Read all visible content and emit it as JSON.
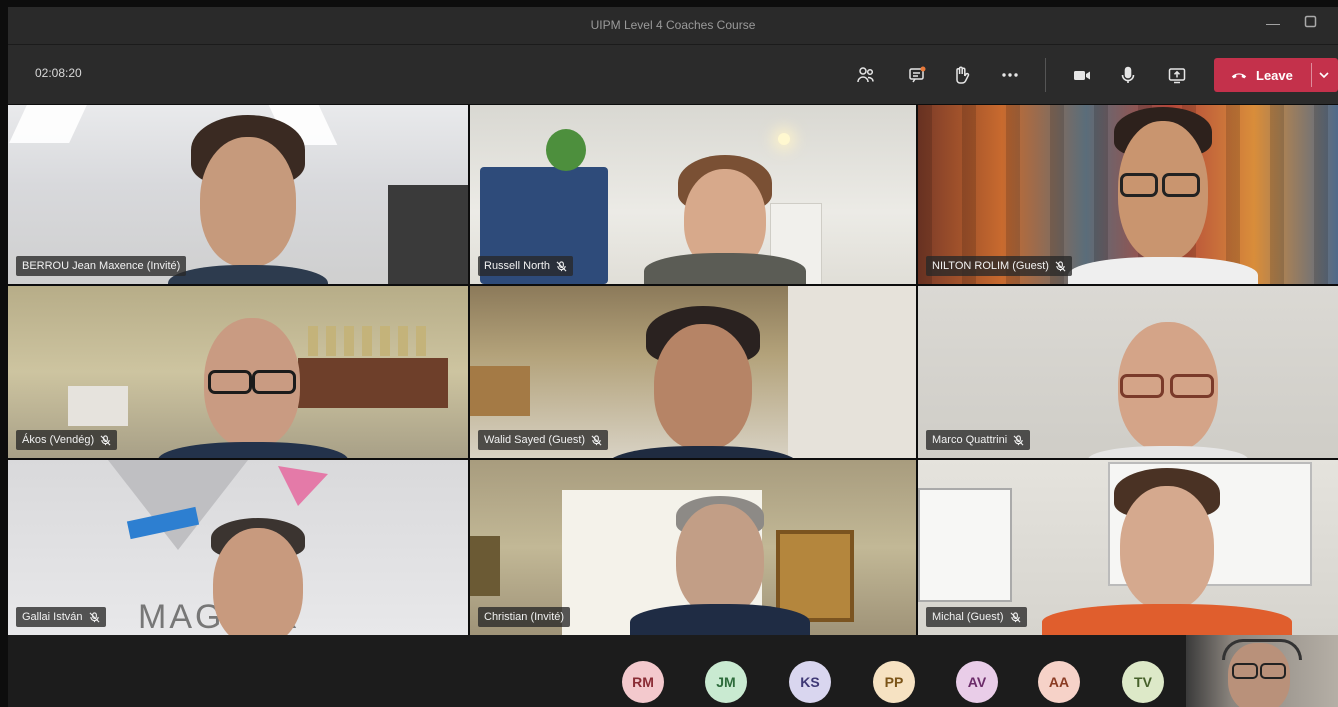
{
  "window": {
    "title": "UIPM Level 4 Coaches Course"
  },
  "toolbar": {
    "timer": "02:08:20",
    "icons": [
      "people-icon",
      "chat-icon",
      "raise-hand-icon",
      "more-icon",
      "camera-icon",
      "mic-icon",
      "share-icon"
    ],
    "leave_label": "Leave"
  },
  "participants": [
    {
      "name": "BERROU Jean Maxence (Invité)",
      "muted": false
    },
    {
      "name": "Russell North",
      "muted": true
    },
    {
      "name": "NILTON ROLIM (Guest)",
      "muted": true
    },
    {
      "name": "Ákos (Vendég)",
      "muted": true
    },
    {
      "name": "Walid Sayed (Guest)",
      "muted": true
    },
    {
      "name": "Marco Quattrini",
      "muted": true
    },
    {
      "name": "Gallai István",
      "muted": true
    },
    {
      "name": "Christian (Invité)",
      "muted": false
    },
    {
      "name": "Michal (Guest)",
      "muted": true
    }
  ],
  "tile_text": {
    "gallai_logo": "MAGYAR"
  },
  "overflow_avatars": [
    {
      "initials": "RM",
      "bg": "#f3c9cd",
      "fg": "#8a2c35"
    },
    {
      "initials": "JM",
      "bg": "#c9ead1",
      "fg": "#2d6b3b"
    },
    {
      "initials": "KS",
      "bg": "#d9d6ef",
      "fg": "#3e3875"
    },
    {
      "initials": "PP",
      "bg": "#f6e2c2",
      "fg": "#7b5418"
    },
    {
      "initials": "AV",
      "bg": "#e9cde8",
      "fg": "#6b2c69"
    },
    {
      "initials": "AA",
      "bg": "#f6d2c8",
      "fg": "#8a3b23"
    },
    {
      "initials": "TV",
      "bg": "#dde9c8",
      "fg": "#46612a"
    }
  ],
  "colors": {
    "leave": "#c4314b",
    "toolbar": "#2b2b2b"
  }
}
